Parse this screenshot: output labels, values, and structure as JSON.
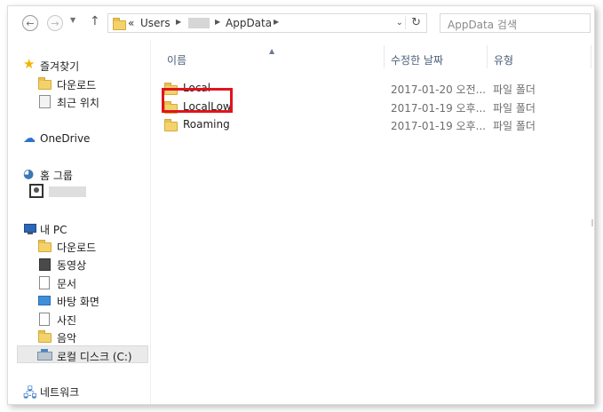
{
  "navbar": {
    "back_icon": "back-arrow-icon",
    "forward_icon": "forward-arrow-icon",
    "up_icon": "up-arrow-icon",
    "address": {
      "overflow": "«",
      "segments": [
        "Users",
        "AppData"
      ],
      "refresh_icon": "refresh-icon"
    },
    "search_placeholder": "AppData 검색"
  },
  "sidebar": {
    "favorites": {
      "label": "즐겨찾기",
      "items": [
        {
          "label": "다운로드",
          "icon": "downloads-folder-icon"
        },
        {
          "label": "최근 위치",
          "icon": "recent-places-icon"
        }
      ]
    },
    "onedrive": {
      "label": "OneDrive"
    },
    "homegroup": {
      "label": "홈 그룹"
    },
    "pc": {
      "label": "내 PC",
      "items": [
        {
          "label": "다운로드",
          "icon": "downloads-folder-icon"
        },
        {
          "label": "동영상",
          "icon": "videos-folder-icon"
        },
        {
          "label": "문서",
          "icon": "documents-folder-icon"
        },
        {
          "label": "바탕 화면",
          "icon": "desktop-folder-icon"
        },
        {
          "label": "사진",
          "icon": "pictures-folder-icon"
        },
        {
          "label": "음악",
          "icon": "music-folder-icon"
        },
        {
          "label": "로컬 디스크 (C:)",
          "icon": "local-disk-icon"
        }
      ]
    },
    "network": {
      "label": "네트워크"
    }
  },
  "main": {
    "columns": {
      "name": "이름",
      "date": "수정한 날짜",
      "type": "유형"
    },
    "rows": [
      {
        "name": "Local",
        "date": "2017-01-20 오전...",
        "type": "파일 폴더"
      },
      {
        "name": "LocalLow",
        "date": "2017-01-19 오후...",
        "type": "파일 폴더"
      },
      {
        "name": "Roaming",
        "date": "2017-01-19 오후...",
        "type": "파일 폴더"
      }
    ]
  },
  "colors": {
    "highlight": "#e0141e",
    "folder": "#f4d26b",
    "header_text": "#4c607a"
  }
}
